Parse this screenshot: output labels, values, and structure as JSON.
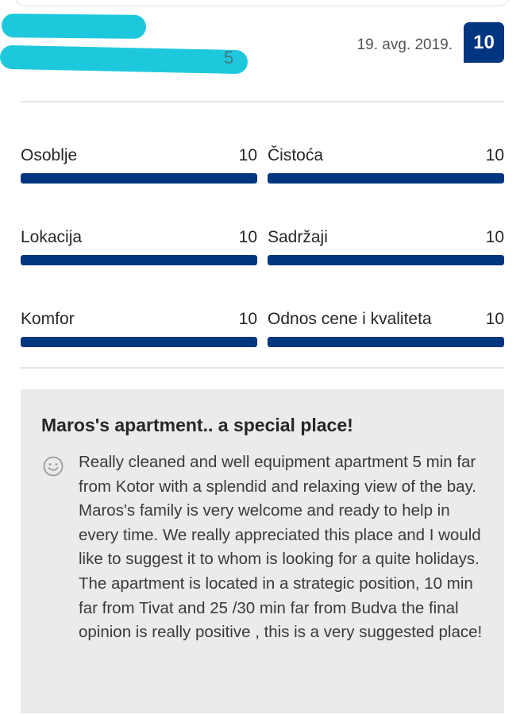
{
  "review": {
    "date": "19. avg. 2019.",
    "score": "10",
    "reviewer_tail": "5",
    "title": "Maros's apartment.. a special place!",
    "positive_text": "Really cleaned and well equipment apartment 5 min far from Kotor with a splendid and relaxing view of the bay. Maros's family is very welcome and ready to help in every time. We really appreciated this place and I would like to suggest it to whom is looking for a quite holidays. The apartment is located in a strategic position, 10 min far from Tivat and 25 /30 min far from Budva the final opinion is really positive , this is a very suggested place!"
  },
  "ratings": [
    {
      "label": "Osoblje",
      "value": "10",
      "fraction": 1.0
    },
    {
      "label": "Čistoća",
      "value": "10",
      "fraction": 1.0
    },
    {
      "label": "Lokacija",
      "value": "10",
      "fraction": 1.0
    },
    {
      "label": "Sadržaji",
      "value": "10",
      "fraction": 1.0
    },
    {
      "label": "Komfor",
      "value": "10",
      "fraction": 1.0
    },
    {
      "label": "Odnos cene i kvaliteta",
      "value": "10",
      "fraction": 1.0
    }
  ],
  "colors": {
    "accent": "#003580",
    "scribble": "#1ec8dc",
    "review_bg": "#ebebeb"
  },
  "icons": {
    "positive": "smiley-icon"
  }
}
